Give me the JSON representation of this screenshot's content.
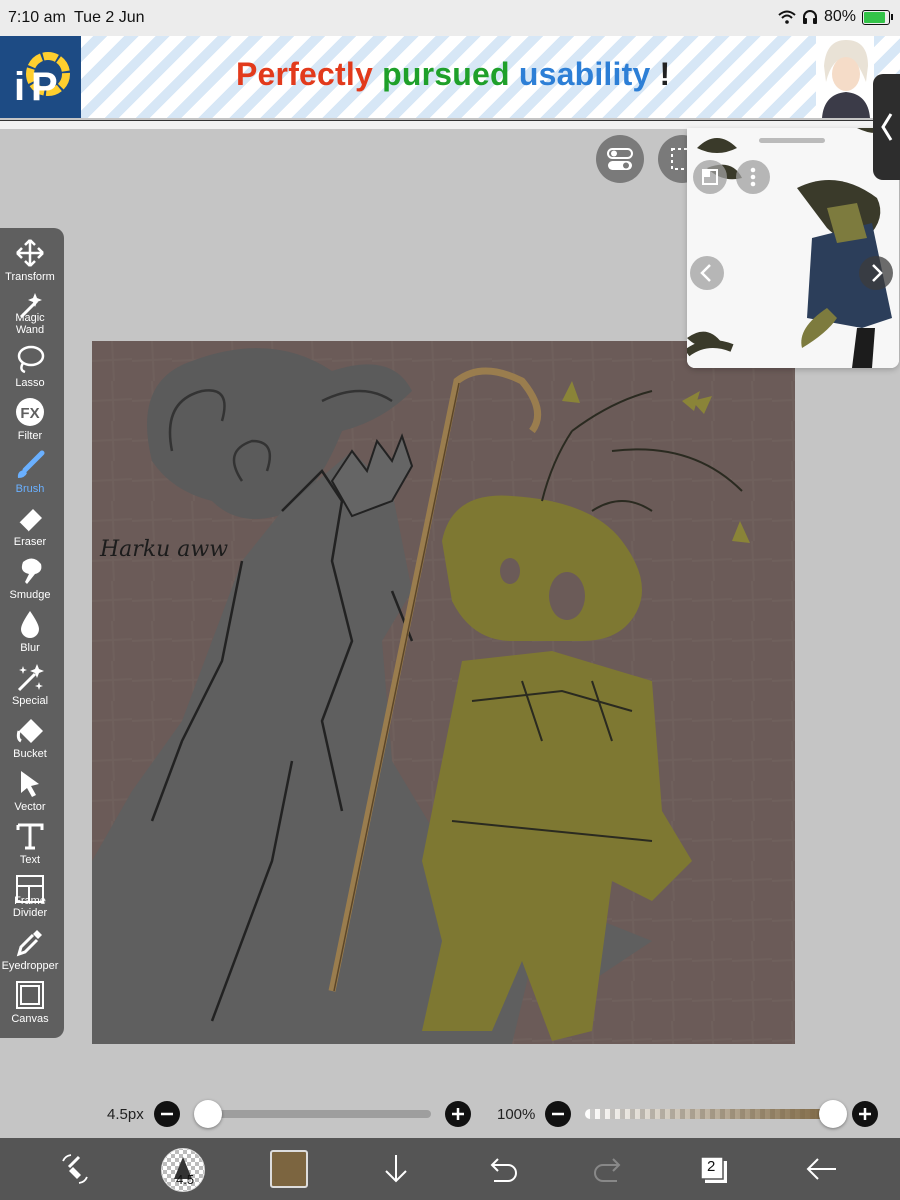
{
  "status": {
    "time": "7:10 am",
    "date": "Tue 2 Jun",
    "battery": "80%"
  },
  "banner": {
    "word1": "Perfectly",
    "word2": "pursued",
    "word3": "usability",
    "excl": "!",
    "logo": "iP"
  },
  "colors": {
    "word1": "#e23a1c",
    "word2": "#1fa02a",
    "word3": "#2d7fd6",
    "accent": "#6ab0ff",
    "toolbar_bg": "#5f5f5f",
    "canvas_bg": "#6b5b58",
    "brush_color": "#7c6540"
  },
  "toolbar": {
    "tools": [
      {
        "label": "Transform",
        "icon": "transform-icon"
      },
      {
        "label": "Magic Wand",
        "icon": "magic-wand-icon"
      },
      {
        "label": "Lasso",
        "icon": "lasso-icon"
      },
      {
        "label": "Filter",
        "icon": "filter-icon"
      },
      {
        "label": "Brush",
        "icon": "brush-icon"
      },
      {
        "label": "Eraser",
        "icon": "eraser-icon"
      },
      {
        "label": "Smudge",
        "icon": "smudge-icon"
      },
      {
        "label": "Blur",
        "icon": "blur-icon"
      },
      {
        "label": "Special",
        "icon": "special-icon"
      },
      {
        "label": "Bucket",
        "icon": "bucket-icon"
      },
      {
        "label": "Vector",
        "icon": "vector-icon"
      },
      {
        "label": "Text",
        "icon": "text-icon"
      },
      {
        "label": "Frame Divider",
        "icon": "frame-divider-icon"
      },
      {
        "label": "Eyedropper",
        "icon": "eyedropper-icon"
      },
      {
        "label": "Canvas",
        "icon": "canvas-icon"
      }
    ],
    "active_tool": "Brush"
  },
  "canvas": {
    "signature": "Harku aww"
  },
  "sliders": {
    "brush_size": "4.5px",
    "opacity": "100%",
    "size_level": 0.02,
    "opacity_level": 1.0
  },
  "bottom": {
    "brush_size_badge": "4.5",
    "layers_count": "2"
  }
}
